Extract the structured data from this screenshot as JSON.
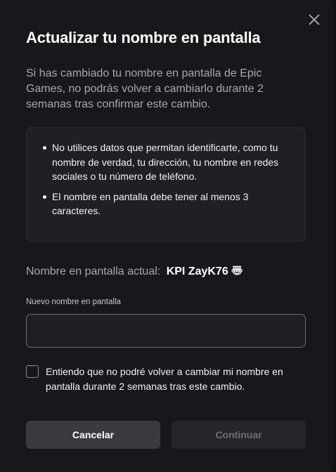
{
  "dialog": {
    "title": "Actualizar tu nombre en pantalla",
    "description": "Si has cambiado tu nombre en pantalla de Epic Games, no podrás volver a cambiarlo durante 2 semanas tras confirmar este cambio.",
    "rules": [
      "No utilices datos que permitan identificarte, como tu nombre de verdad, tu dirección, tu nombre en redes sociales o tu número de teléfono.",
      "El nombre en pantalla debe tener al menos 3 caracteres."
    ],
    "current_name_label": "Nombre en pantalla actual:",
    "current_name_value": "KPI ZayK76 〠",
    "new_name_label": "Nuevo nombre en pantalla",
    "new_name_value": "",
    "confirm_text": "Entiendo que no podré volver a cambiar mi nombre en pantalla durante 2 semanas tras este cambio.",
    "confirm_checked": false,
    "cancel_label": "Cancelar",
    "continue_label": "Continuar",
    "continue_enabled": false
  },
  "icons": {
    "close": "close-icon"
  },
  "colors": {
    "background": "#18181c",
    "panel": "#202024",
    "text_primary": "#ffffff",
    "text_secondary": "#a7a7ad",
    "button_secondary": "#3a3a40",
    "button_disabled": "#26262a"
  }
}
